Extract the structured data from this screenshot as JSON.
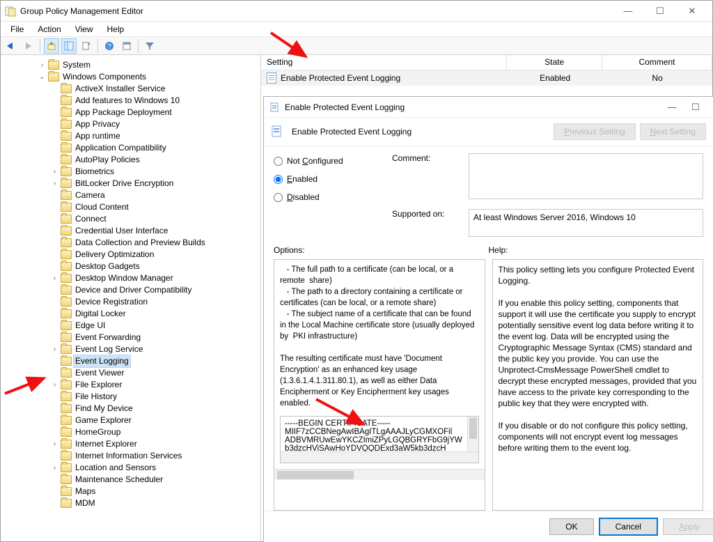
{
  "window": {
    "title": "Group Policy Management Editor"
  },
  "menu": {
    "file": "File",
    "action": "Action",
    "view": "View",
    "help": "Help"
  },
  "tree": {
    "root": [
      {
        "label": "System",
        "exp": ">"
      },
      {
        "label": "Windows Components",
        "exp": "v",
        "children": [
          {
            "label": "ActiveX Installer Service"
          },
          {
            "label": "Add features to Windows 10"
          },
          {
            "label": "App Package Deployment"
          },
          {
            "label": "App Privacy"
          },
          {
            "label": "App runtime"
          },
          {
            "label": "Application Compatibility"
          },
          {
            "label": "AutoPlay Policies"
          },
          {
            "label": "Biometrics",
            "exp": ">"
          },
          {
            "label": "BitLocker Drive Encryption",
            "exp": ">"
          },
          {
            "label": "Camera"
          },
          {
            "label": "Cloud Content"
          },
          {
            "label": "Connect"
          },
          {
            "label": "Credential User Interface"
          },
          {
            "label": "Data Collection and Preview Builds"
          },
          {
            "label": "Delivery Optimization"
          },
          {
            "label": "Desktop Gadgets"
          },
          {
            "label": "Desktop Window Manager",
            "exp": ">"
          },
          {
            "label": "Device and Driver Compatibility"
          },
          {
            "label": "Device Registration"
          },
          {
            "label": "Digital Locker"
          },
          {
            "label": "Edge UI"
          },
          {
            "label": "Event Forwarding"
          },
          {
            "label": "Event Log Service",
            "exp": ">"
          },
          {
            "label": "Event Logging",
            "selected": true
          },
          {
            "label": "Event Viewer"
          },
          {
            "label": "File Explorer",
            "exp": ">"
          },
          {
            "label": "File History"
          },
          {
            "label": "Find My Device"
          },
          {
            "label": "Game Explorer"
          },
          {
            "label": "HomeGroup"
          },
          {
            "label": "Internet Explorer",
            "exp": ">"
          },
          {
            "label": "Internet Information Services"
          },
          {
            "label": "Location and Sensors",
            "exp": ">"
          },
          {
            "label": "Maintenance Scheduler"
          },
          {
            "label": "Maps"
          },
          {
            "label": "MDM"
          }
        ]
      }
    ]
  },
  "grid": {
    "headers": {
      "setting": "Setting",
      "state": "State",
      "comment": "Comment"
    },
    "row": {
      "setting": "Enable Protected Event Logging",
      "state": "Enabled",
      "comment": "No"
    }
  },
  "dialog": {
    "title": "Enable Protected Event Logging",
    "header": "Enable Protected Event Logging",
    "prev": "Previous Setting",
    "next": "Next Setting",
    "radios": {
      "not": "Not Configured",
      "en": "Enabled",
      "dis": "Disabled"
    },
    "comment_label": "Comment:",
    "supported_label": "Supported on:",
    "supported_value": "At least Windows Server 2016, Windows 10",
    "options_label": "Options:",
    "help_label": "Help:",
    "options_text": "   - The full path to a certificate (can be local, or a remote  share)\n   - The path to a directory containing a certificate or certificates (can be local, or a remote share)\n   - The subject name of a certificate that can be found in the Local Machine certificate store (usually deployed by  PKI infrastructure)\n\nThe resulting certificate must have 'Document Encryption' as an enhanced key usage (1.3.6.1.4.1.311.80.1), as well as either Data Encipherment or Key Encipherment key usages enabled.",
    "cert_lines": [
      "-----BEGIN CERTIFICATE-----",
      "MIIF7zCCBNegAwIBAgITLgAAAJLyCGMXOFil",
      "ADBVMRUwEwYKCZImiZPyLGQBGRYFbG9jYW",
      "b3dzcHViSAwHoYDVQQDExd3aW5kb3dzcH"
    ],
    "help_text": "This policy setting lets you configure Protected Event Logging.\n\nIf you enable this policy setting, components that support it will use the certificate you supply to encrypt potentially sensitive event log data before writing it to the event log. Data will be encrypted using the Cryptographic Message Syntax (CMS) standard and the public key you provide. You can use the Unprotect-CmsMessage PowerShell cmdlet to decrypt these encrypted messages, provided that you have access to the private key corresponding to the public key that they were encrypted with.\n\nIf you disable or do not configure this policy setting, components will not encrypt event log messages before writing them to the event log.",
    "ok": "OK",
    "cancel": "Cancel",
    "apply": "Apply"
  }
}
